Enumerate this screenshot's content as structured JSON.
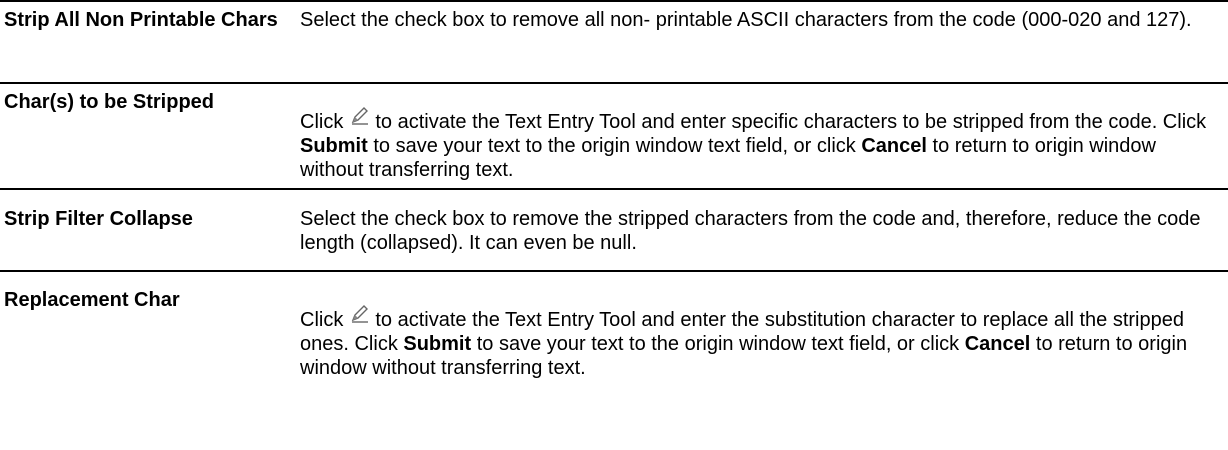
{
  "rows": [
    {
      "term": "Strip All Non Printable Chars",
      "desc": "Select the check box to remove all non- printable ASCII characters from the code (000-020 and 127)."
    },
    {
      "term": "Char(s) to be Stripped",
      "desc_pre": "Click",
      "desc_mid1": "to activate the Text Entry Tool and enter specific characters to be stripped from the code. Click",
      "submit": "Submit",
      "desc_mid2": "to save your text to the origin window text field, or click",
      "cancel": "Cancel",
      "desc_post": "to return to origin window without transferring text."
    },
    {
      "term": "Strip Filter Collapse",
      "desc": "Select the check box to remove the stripped characters from the code and, therefore, reduce the code length (collapsed). It can even be null."
    },
    {
      "term": "Replacement Char",
      "desc_pre": "Click",
      "desc_mid1": "to activate the Text Entry Tool and enter the substitution character to replace all the stripped ones. Click",
      "submit": "Submit",
      "desc_mid2": "to save your text to the origin window text field, or click",
      "cancel": "Cancel",
      "desc_post": "to return to origin window without transferring text."
    }
  ],
  "icons": {
    "edit": "pencil-icon"
  },
  "colors": {
    "rule": "#000000",
    "text": "#000000"
  }
}
